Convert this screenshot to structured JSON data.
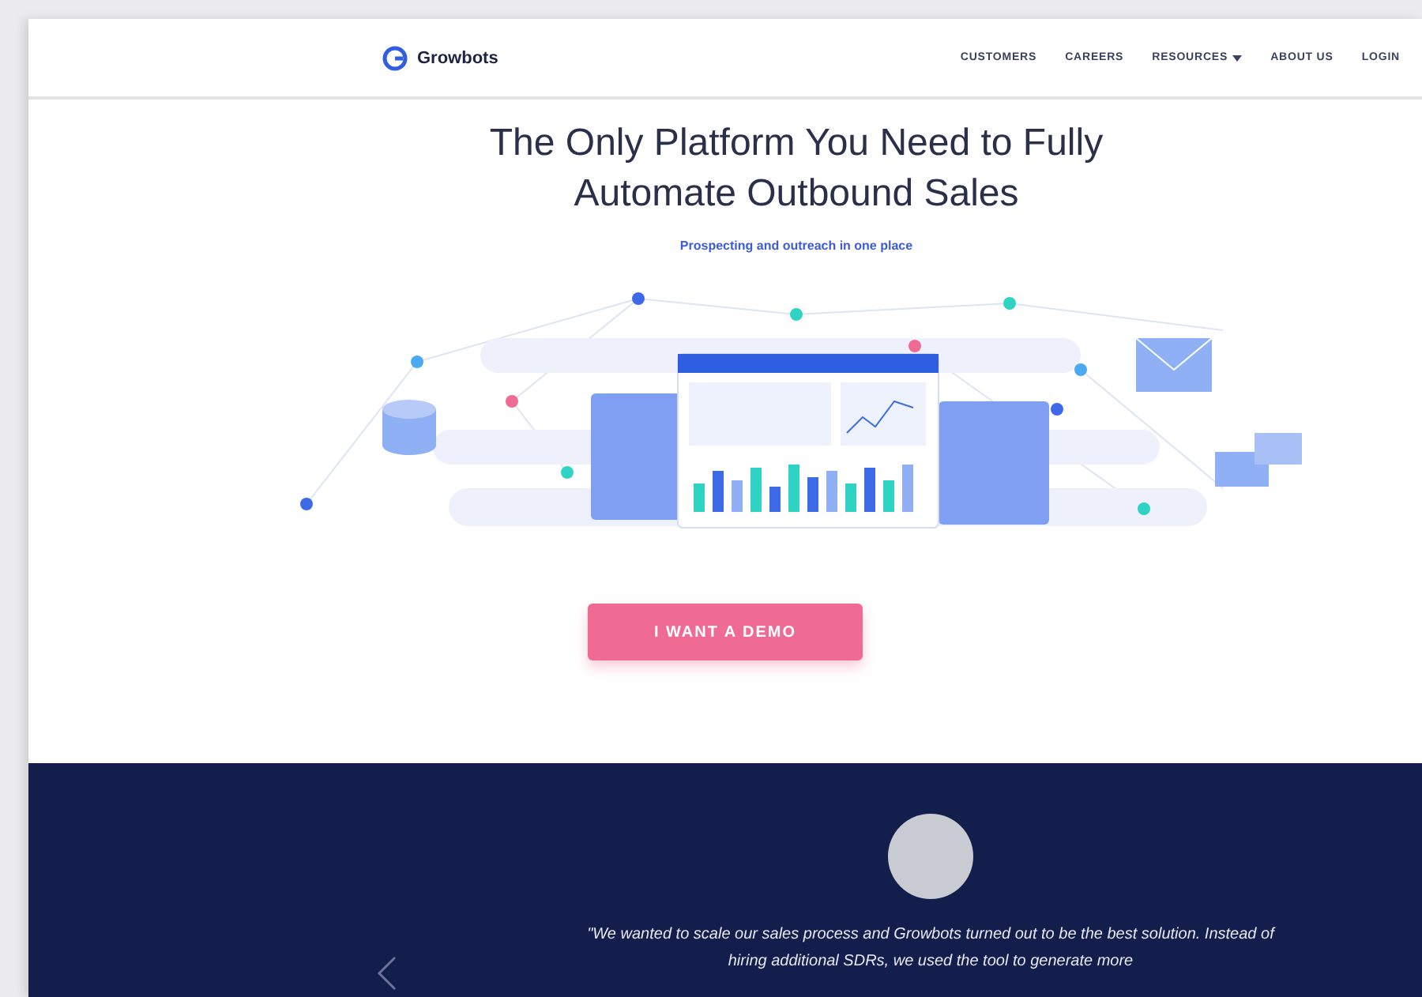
{
  "brand": {
    "name": "Growbots"
  },
  "nav": [
    {
      "label": "CUSTOMERS",
      "kind": "link"
    },
    {
      "label": "CAREERS",
      "kind": "link"
    },
    {
      "label": "RESOURCES",
      "kind": "dropdown"
    },
    {
      "label": "ABOUT US",
      "kind": "link"
    },
    {
      "label": "LOGIN",
      "kind": "link"
    }
  ],
  "hero": {
    "title": "The Only Platform You Need to Fully Automate Outbound Sales",
    "subtitle": "Prospecting and outreach in one place",
    "cta": "I WANT A DEMO"
  },
  "testimonial": {
    "quote": "\"We wanted to scale our sales process and Growbots turned out to be the best solution. Instead of hiring additional SDRs, we used the tool to generate more"
  }
}
